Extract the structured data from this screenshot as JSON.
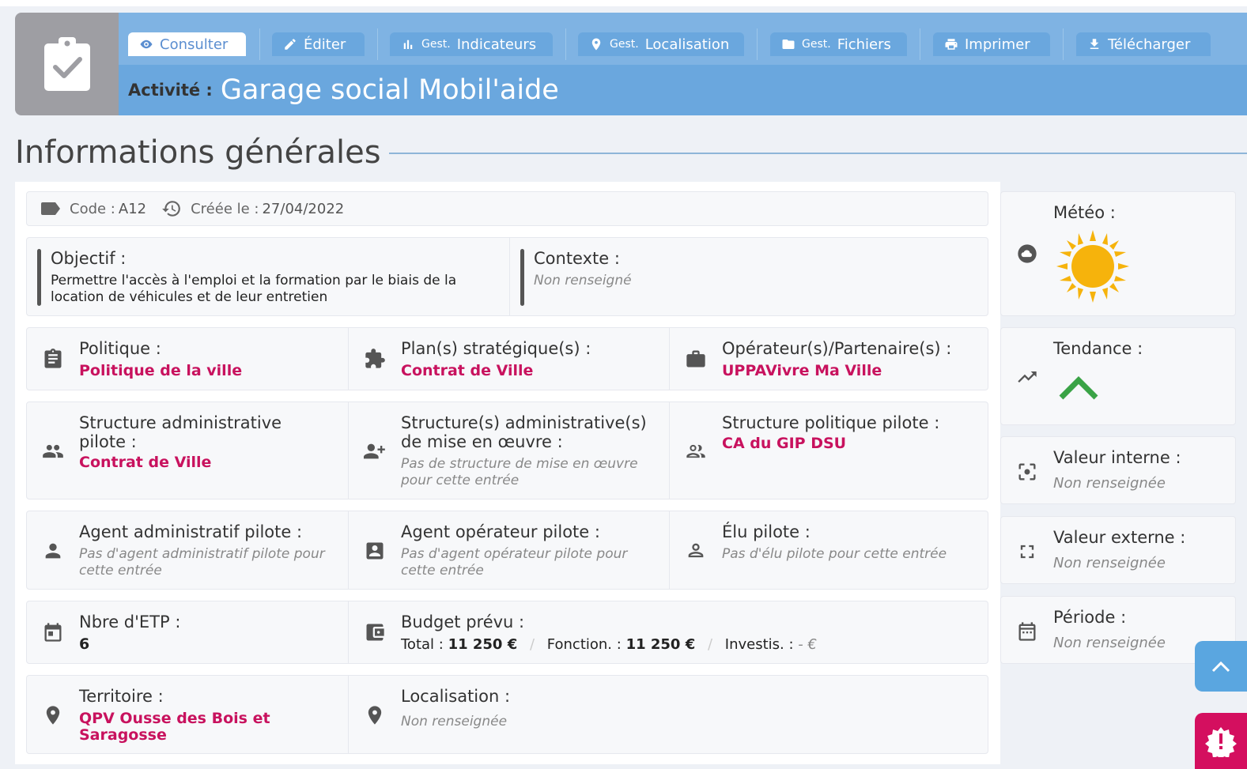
{
  "header": {
    "title_label": "Activité :",
    "title_value": "Garage social Mobil'aide",
    "tabs": [
      {
        "label": "Consulter",
        "prefix": "",
        "icon": "eye-icon",
        "active": true
      },
      {
        "label": "Éditer",
        "prefix": "",
        "icon": "pencil-icon",
        "active": false
      },
      {
        "label": "Indicateurs",
        "prefix": "Gest.",
        "icon": "bar-chart-icon",
        "active": false
      },
      {
        "label": "Localisation",
        "prefix": "Gest.",
        "icon": "map-pin-icon",
        "active": false
      },
      {
        "label": "Fichiers",
        "prefix": "Gest.",
        "icon": "folder-icon",
        "active": false
      },
      {
        "label": "Imprimer",
        "prefix": "",
        "icon": "printer-icon",
        "active": false
      },
      {
        "label": "Télécharger",
        "prefix": "",
        "icon": "download-icon",
        "active": false
      }
    ]
  },
  "section": {
    "title": "Informations générales"
  },
  "meta": {
    "code_label": "Code :",
    "code_value": "A12",
    "created_label": "Créée le :",
    "created_value": "27/04/2022"
  },
  "objectif": {
    "label": "Objectif :",
    "value": "Permettre l'accès à l'emploi et la formation par le biais de la location de véhicules et de leur entretien"
  },
  "contexte": {
    "label": "Contexte :",
    "value": "Non renseigné"
  },
  "row1": {
    "politique": {
      "label": "Politique :",
      "value": "Politique de la ville"
    },
    "plan": {
      "label": "Plan(s) stratégique(s) :",
      "value": "Contrat de Ville"
    },
    "operateur": {
      "label": "Opérateur(s)/Partenaire(s) :",
      "value": "UPPAVivre Ma Ville"
    }
  },
  "row2": {
    "structure_admin": {
      "label": "Structure administrative pilote :",
      "value": "Contrat de Ville"
    },
    "structure_mise": {
      "label": "Structure(s) administrative(s) de mise en œuvre :",
      "value": "Pas de structure de mise en œuvre pour cette entrée"
    },
    "structure_pol": {
      "label": "Structure politique pilote :",
      "value": "CA du GIP DSU"
    }
  },
  "row3": {
    "agent_admin": {
      "label": "Agent administratif pilote :",
      "value": "Pas d'agent administratif pilote pour cette entrée"
    },
    "agent_op": {
      "label": "Agent opérateur pilote :",
      "value": "Pas d'agent opérateur pilote pour cette entrée"
    },
    "elu": {
      "label": "Élu pilote :",
      "value": "Pas d'élu pilote pour cette entrée"
    }
  },
  "row4": {
    "etp": {
      "label": "Nbre d'ETP :",
      "value": "6"
    },
    "budget": {
      "label": "Budget prévu :",
      "total_label": "Total :",
      "total_value": "11 250 €",
      "fonction_label": "Fonction. :",
      "fonction_value": "11 250 €",
      "invest_label": "Investis. :",
      "invest_value": "- €"
    }
  },
  "row5": {
    "territoire": {
      "label": "Territoire :",
      "value": "QPV Ousse des Bois et Saragosse"
    },
    "localisation": {
      "label": "Localisation :",
      "value": "Non renseignée"
    }
  },
  "right": {
    "meteo": {
      "label": "Météo :",
      "icon": "sun-icon"
    },
    "tendance": {
      "label": "Tendance :",
      "icon": "chevron-up-icon"
    },
    "valeur_interne": {
      "label": "Valeur interne :",
      "value": "Non renseignée"
    },
    "valeur_externe": {
      "label": "Valeur externe :",
      "value": "Non renseignée"
    },
    "periode": {
      "label": "Période :",
      "value": "Non renseignée"
    }
  },
  "colors": {
    "header": "#6aa7de",
    "accent": "#c8125e",
    "sun": "#f6b30c",
    "trend": "#3aa346",
    "alert": "#d40f5f"
  }
}
